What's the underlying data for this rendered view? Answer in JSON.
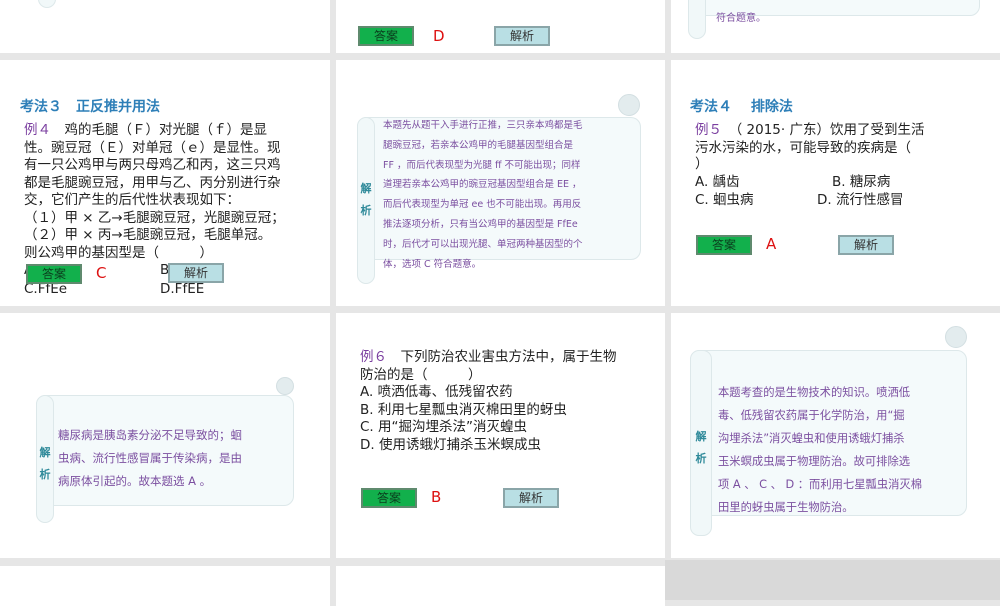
{
  "buttons": {
    "answer": "答案",
    "analysis": "解析"
  },
  "jiexi": [
    "解",
    "析"
  ],
  "slide_top_middle": {
    "answer": "D"
  },
  "slide_top_right": {
    "analysis_tail": "符合题意。"
  },
  "slide_method3": {
    "heading": "考法３　正反推并用法",
    "example_label": "例４",
    "lines": [
      "　鸡的毛腿（Ｆ）对光腿（ｆ）是显",
      "性。豌豆冠（Ｅ）对单冠（ｅ）是显性。现",
      "有一只公鸡甲与两只母鸡乙和丙，这三只鸡",
      "都是毛腿豌豆冠，用甲与乙、丙分别进行杂",
      "交，它们产生的后代性状表现如下：",
      "（１）甲 × 乙→毛腿豌豆冠，光腿豌豆冠；",
      "（２）甲 × 丙→毛腿豌豆冠，毛腿单冠。",
      "则公鸡甲的基因型是（　　　）"
    ],
    "options": [
      "A",
      "B",
      "C.FfEe",
      "D.FfEE"
    ],
    "answer": "C"
  },
  "slide_analysis4": {
    "lines": [
      "本题先从题干入手进行正推，三只亲本鸡都是毛",
      "腿豌豆冠，若亲本公鸡甲的毛腿基因型组合是",
      "FF ，而后代表现型为光腿 ff 不可能出现；同样",
      "道理若亲本公鸡甲的豌豆冠基因型组合是 EE ，",
      "而后代表现型为单冠 ee 也不可能出现。再用反",
      "推法逐项分析，只有当公鸡甲的基因型是 FfEe",
      "时，后代才可以出现光腿、单冠两种基因型的个",
      "体，选项 C 符合题意。"
    ]
  },
  "slide_method4": {
    "heading": "考法４　 排除法",
    "example_label": "例５",
    "lines": [
      "　（ 2015· 广东）饮用了受到生活",
      "污水污染的水，可能导致的疾病是（",
      " ）"
    ],
    "options": [
      "A. 龋齿",
      "B. 糖尿病",
      "C. 蛔虫病",
      "D. 流行性感冒"
    ],
    "answer": "A"
  },
  "slide_analysis5": {
    "lines": [
      "糖尿病是胰岛素分泌不足导致的；蛔",
      "虫病、流行性感冒属于传染病，是由",
      "病原体引起的。故本题选 A 。"
    ]
  },
  "slide_example6": {
    "example_label": "例６",
    "lines": [
      "　下列防治农业害虫方法中，属于生物",
      "防治的是（　　　）"
    ],
    "options": [
      "A. 喷洒低毒、低残留农药",
      "B. 利用七星瓢虫消灭棉田里的蚜虫",
      "C. 用“掘沟埋杀法”消灭蝗虫",
      "D. 使用诱蛾灯捕杀玉米螟成虫"
    ],
    "answer": "B"
  },
  "slide_analysis6": {
    "lines": [
      "本题考查的是生物技术的知识。喷洒低",
      "毒、低残留农药属于化学防治，用“掘",
      "沟埋杀法”消灭蝗虫和使用诱蛾灯捕杀",
      "玉米螟成虫属于物理防治。故可排除选",
      "项 A 、 C 、 D ：而利用七星瓢虫消灭棉",
      "田里的蚜虫属于生物防治。"
    ]
  }
}
